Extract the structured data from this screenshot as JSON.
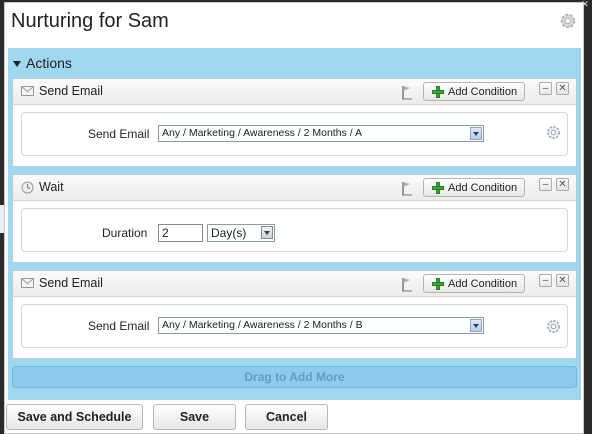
{
  "dialog": {
    "title": "Nurturing for Sam",
    "settings_icon": "gear-icon"
  },
  "actions": {
    "header": "Actions",
    "cards": [
      {
        "type": "Send Email",
        "icon": "envelope-icon",
        "add_condition_label": "Add Condition",
        "field_label": "Send Email",
        "field_value": "Any / Marketing / Awareness / 2 Months / A"
      },
      {
        "type": "Wait",
        "icon": "clock-icon",
        "add_condition_label": "Add Condition",
        "field_label": "Duration",
        "duration_value": "2",
        "unit_value": "Day(s)"
      },
      {
        "type": "Send Email",
        "icon": "envelope-icon",
        "add_condition_label": "Add Condition",
        "field_label": "Send Email",
        "field_value": "Any / Marketing / Awareness / 2 Months / B"
      }
    ],
    "drag_label": "Drag to Add More"
  },
  "footer": {
    "save_schedule_label": "Save and Schedule",
    "save_label": "Save",
    "cancel_label": "Cancel"
  },
  "colors": {
    "panel": "#9fd6f0",
    "drag_bar": "#8ccbeb",
    "plus": "#3aa33a"
  }
}
